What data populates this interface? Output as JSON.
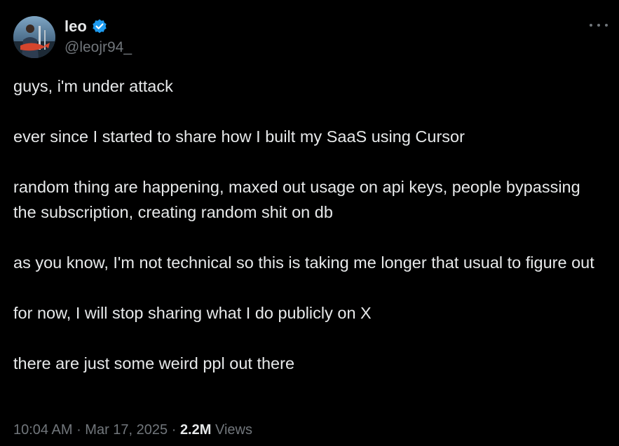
{
  "author": {
    "display_name": "leo",
    "handle": "@leojr94_",
    "avatar_icon": "profile-photo",
    "verified_icon": "verified-badge-icon",
    "verified_color": "#1d9bf0"
  },
  "menu_icon": "more-options-icon",
  "tweet": {
    "paragraphs": [
      "guys, i'm under attack",
      "ever since I started to share how I built my SaaS using Cursor",
      "random thing are happening, maxed out usage on api keys, people bypassing the subscription, creating random shit on db",
      "as you know, I'm not technical so this is taking me longer that usual to figure out",
      "for now, I will stop sharing what I do publicly on X",
      "there are just some weird ppl out there"
    ]
  },
  "meta": {
    "time": "10:04 AM",
    "separator": " · ",
    "date": "Mar 17, 2025",
    "views_count": "2.2M",
    "views_label": " Views"
  },
  "colors": {
    "background": "#000000",
    "text": "#e7e9ea",
    "secondary_text": "#71767b"
  }
}
